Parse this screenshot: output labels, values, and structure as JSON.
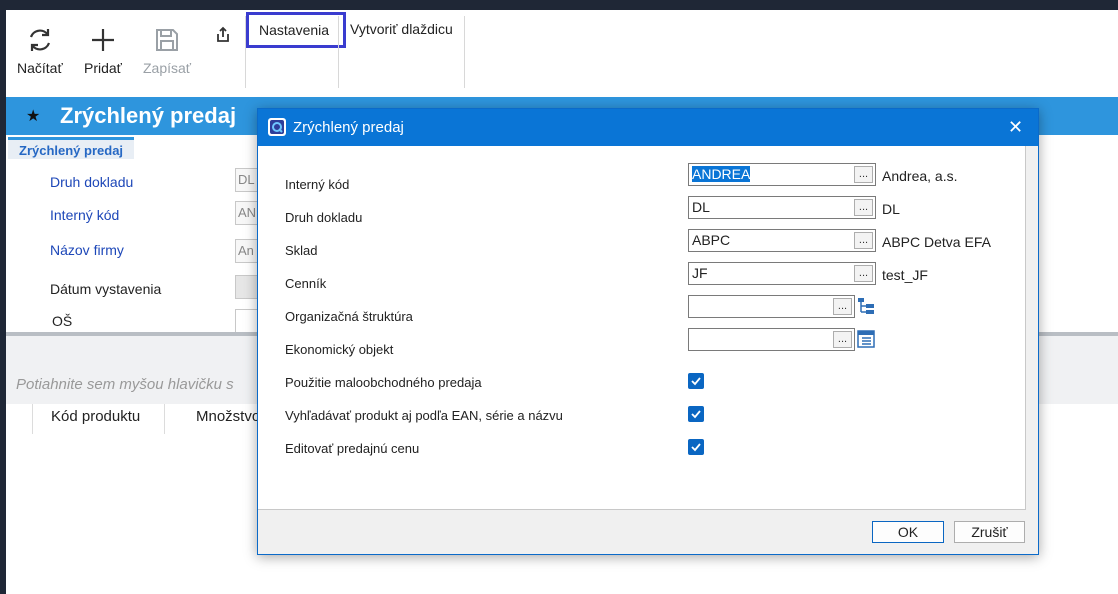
{
  "toolbar": {
    "reload_label": "Načítať",
    "add_label": "Pridať",
    "save_label": "Zapísať",
    "tabs": [
      {
        "label": "Nastavenia",
        "active": true
      },
      {
        "label": "Vytvoriť dlaždicu",
        "active": false
      }
    ]
  },
  "page": {
    "title": "Zrýchlený predaj",
    "subtab": "Zrýchlený predaj",
    "fields": [
      {
        "label": "Druh dokladu",
        "value": "DL"
      },
      {
        "label": "Interný kód",
        "value": "AN"
      },
      {
        "label": "Názov firmy",
        "value": "An"
      },
      {
        "label": "Dátum vystavenia",
        "value": ""
      },
      {
        "label": "OŠ",
        "value": ""
      }
    ],
    "group_by_hint": "Potiahnite sem myšou hlavičku s",
    "columns": [
      "Kód produktu",
      "Množstvo"
    ]
  },
  "dialog": {
    "title": "Zrýchlený predaj",
    "rows": [
      {
        "label": "Interný kód",
        "value": "ANDREA",
        "selected": true,
        "desc": "Andrea, a.s."
      },
      {
        "label": "Druh dokladu",
        "value": "DL",
        "desc": "DL"
      },
      {
        "label": "Sklad",
        "value": "ABPC",
        "desc": "ABPC Detva EFA"
      },
      {
        "label": "Cenník",
        "value": "JF",
        "desc": "test_JF"
      },
      {
        "label": "Organizačná štruktúra",
        "value": ""
      },
      {
        "label": "Ekonomický objekt",
        "value": ""
      }
    ],
    "checks": [
      {
        "label": "Použitie maloobchodného predaja",
        "checked": true
      },
      {
        "label": "Vyhľadávať produkt aj podľa EAN, série a názvu",
        "checked": true
      },
      {
        "label": "Editovať predajnú cenu",
        "checked": true
      }
    ],
    "lookup_button": "...",
    "close_symbol": "✕",
    "ok_label": "OK",
    "cancel_label": "Zrušiť"
  },
  "colors": {
    "accent": "#0a75d6",
    "title_bar": "#2e95dd",
    "link": "#1d47b8",
    "active_tab_border": "#3a3ccf"
  },
  "icons": {
    "reload": "refresh-icon",
    "add": "plus-icon",
    "save": "floppy-disk-icon",
    "share": "share-icon",
    "favorite": "star-icon",
    "app": "app-logo-icon",
    "tree": "tree-structure-icon",
    "check": "checkmark-icon"
  }
}
